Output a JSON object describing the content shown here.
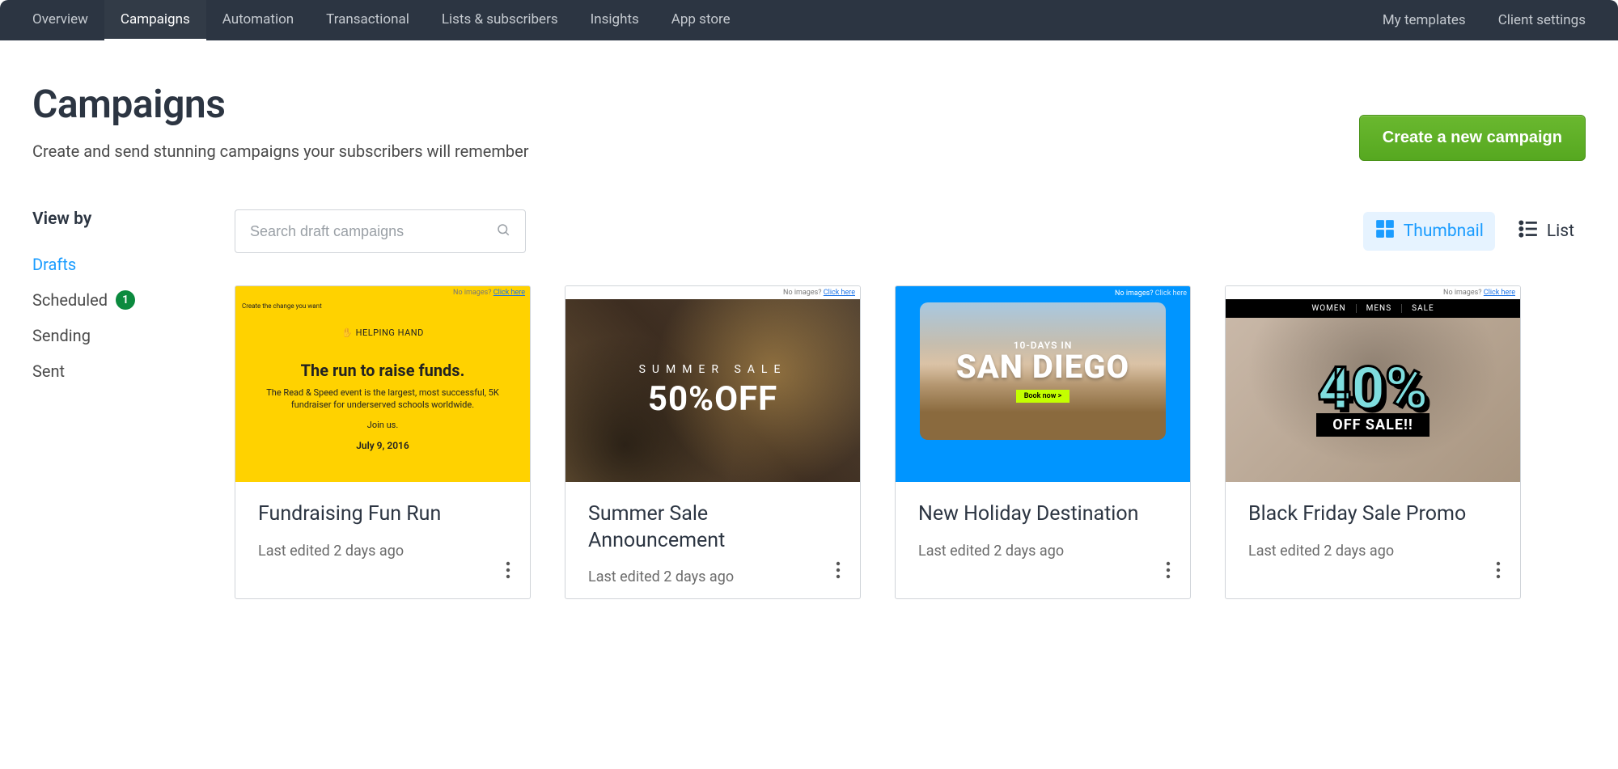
{
  "nav": {
    "left": [
      "Overview",
      "Campaigns",
      "Automation",
      "Transactional",
      "Lists & subscribers",
      "Insights",
      "App store"
    ],
    "right": [
      "My templates",
      "Client settings"
    ],
    "activeIndex": 1
  },
  "page": {
    "title": "Campaigns",
    "subtitle": "Create and send stunning campaigns your subscribers will remember",
    "create_btn": "Create a new campaign"
  },
  "sidebar": {
    "heading": "View by",
    "items": [
      {
        "label": "Drafts",
        "active": true,
        "badge": null
      },
      {
        "label": "Scheduled",
        "active": false,
        "badge": "1"
      },
      {
        "label": "Sending",
        "active": false,
        "badge": null
      },
      {
        "label": "Sent",
        "active": false,
        "badge": null
      }
    ]
  },
  "search": {
    "placeholder": "Search draft campaigns"
  },
  "viewswitch": {
    "thumbnail": "Thumbnail",
    "list": "List",
    "active": "thumbnail"
  },
  "cards": [
    {
      "title": "Fundraising Fun Run",
      "subtitle": "Last edited 2 days ago",
      "thumb": {
        "type": "t1",
        "linkbar_prefix": "No images? ",
        "linkbar_link": "Click here",
        "topnote": "Create the change you want",
        "logo": "✋ HELPING HAND",
        "headline": "The run to raise funds.",
        "body": "The Read & Speed event is the largest, most successful, 5K fundraiser for underserved schools worldwide.",
        "join": "Join us.",
        "date": "July 9, 2016"
      }
    },
    {
      "title": "Summer Sale Announcement",
      "subtitle": "Last edited 2 days ago",
      "thumb": {
        "type": "t2",
        "linkbar_prefix": "No images? ",
        "linkbar_link": "Click here",
        "small": "SUMMER SALE",
        "big": "50%OFF"
      }
    },
    {
      "title": "New Holiday Destination",
      "subtitle": "Last edited 2 days ago",
      "thumb": {
        "type": "t3",
        "linkbar_prefix": "No images? ",
        "linkbar_link": "Click here",
        "top": "10-DAYS IN",
        "main": "SAN DIEGO",
        "btn": "Book now >"
      }
    },
    {
      "title": "Black Friday Sale Promo",
      "subtitle": "Last edited 2 days ago",
      "thumb": {
        "type": "t4",
        "linkbar_prefix": "No images? ",
        "linkbar_link": "Click here",
        "menu": [
          "WOMEN",
          "MENS",
          "SALE"
        ],
        "forty": "40%",
        "off": "OFF SALE!!"
      }
    }
  ]
}
